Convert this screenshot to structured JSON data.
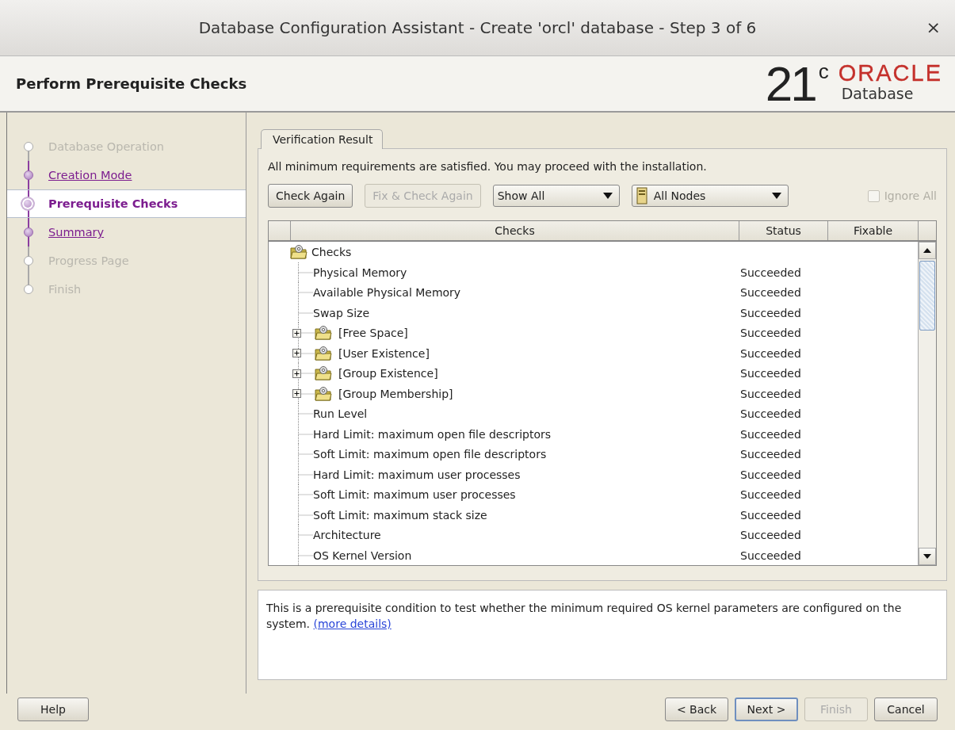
{
  "window": {
    "title": "Database Configuration Assistant - Create 'orcl' database - Step 3 of 6",
    "close": "×"
  },
  "header": {
    "title": "Perform Prerequisite Checks",
    "logo": {
      "version": "21",
      "suffix": "c",
      "brand": "ORACLE",
      "product": "Database"
    }
  },
  "steps": [
    {
      "label": "Database Operation",
      "enabled": false,
      "selected": false
    },
    {
      "label": "Creation Mode",
      "enabled": true,
      "selected": false
    },
    {
      "label": "Prerequisite Checks",
      "enabled": true,
      "selected": true
    },
    {
      "label": "Summary",
      "enabled": true,
      "selected": false
    },
    {
      "label": "Progress Page",
      "enabled": false,
      "selected": false
    },
    {
      "label": "Finish",
      "enabled": false,
      "selected": false
    }
  ],
  "tab": {
    "label": "Verification Result",
    "selected": true
  },
  "message": "All minimum requirements are satisfied. You may proceed with the installation.",
  "toolbar": {
    "check_again": {
      "label": "Check Again",
      "disabled": false
    },
    "fix_check_again": {
      "label": "Fix & Check Again",
      "disabled": true
    },
    "filter": {
      "value": "Show All"
    },
    "nodes": {
      "value": "All Nodes"
    },
    "ignore_all": {
      "label": "Ignore All",
      "checked": false,
      "disabled": true
    }
  },
  "table": {
    "columns": [
      "Checks",
      "Status",
      "Fixable"
    ],
    "rows": [
      {
        "label": "Checks",
        "kind": "root",
        "children": [
          {
            "label": "Physical Memory",
            "status": "Succeeded",
            "kind": "item"
          },
          {
            "label": "Available Physical Memory",
            "status": "Succeeded",
            "kind": "item"
          },
          {
            "label": "Swap Size",
            "status": "Succeeded",
            "kind": "item"
          },
          {
            "label": "[Free Space]",
            "status": "Succeeded",
            "kind": "group",
            "expanded": false
          },
          {
            "label": "[User Existence]",
            "status": "Succeeded",
            "kind": "group",
            "expanded": false
          },
          {
            "label": "[Group Existence]",
            "status": "Succeeded",
            "kind": "group",
            "expanded": false
          },
          {
            "label": "[Group Membership]",
            "status": "Succeeded",
            "kind": "group",
            "expanded": false
          },
          {
            "label": "Run Level",
            "status": "Succeeded",
            "kind": "item"
          },
          {
            "label": "Hard Limit: maximum open file descriptors",
            "status": "Succeeded",
            "kind": "item"
          },
          {
            "label": "Soft Limit: maximum open file descriptors",
            "status": "Succeeded",
            "kind": "item"
          },
          {
            "label": "Hard Limit: maximum user processes",
            "status": "Succeeded",
            "kind": "item"
          },
          {
            "label": "Soft Limit: maximum user processes",
            "status": "Succeeded",
            "kind": "item"
          },
          {
            "label": "Soft Limit: maximum stack size",
            "status": "Succeeded",
            "kind": "item"
          },
          {
            "label": "Architecture",
            "status": "Succeeded",
            "kind": "item"
          },
          {
            "label": "OS Kernel Version",
            "status": "Succeeded",
            "kind": "item"
          }
        ]
      }
    ]
  },
  "description": {
    "text": "This is a prerequisite condition to test whether the minimum required OS kernel parameters are configured on the system.",
    "link": "(more details)"
  },
  "buttons": [
    {
      "label": "Help",
      "kind": "help",
      "disabled": false,
      "default": false
    },
    {
      "label": "< Back",
      "kind": "nav",
      "disabled": false,
      "default": false
    },
    {
      "label": "Next >",
      "kind": "nav",
      "disabled": false,
      "default": true
    },
    {
      "label": "Finish",
      "kind": "nav",
      "disabled": true,
      "default": false
    },
    {
      "label": "Cancel",
      "kind": "cancel",
      "disabled": false,
      "default": false
    }
  ]
}
